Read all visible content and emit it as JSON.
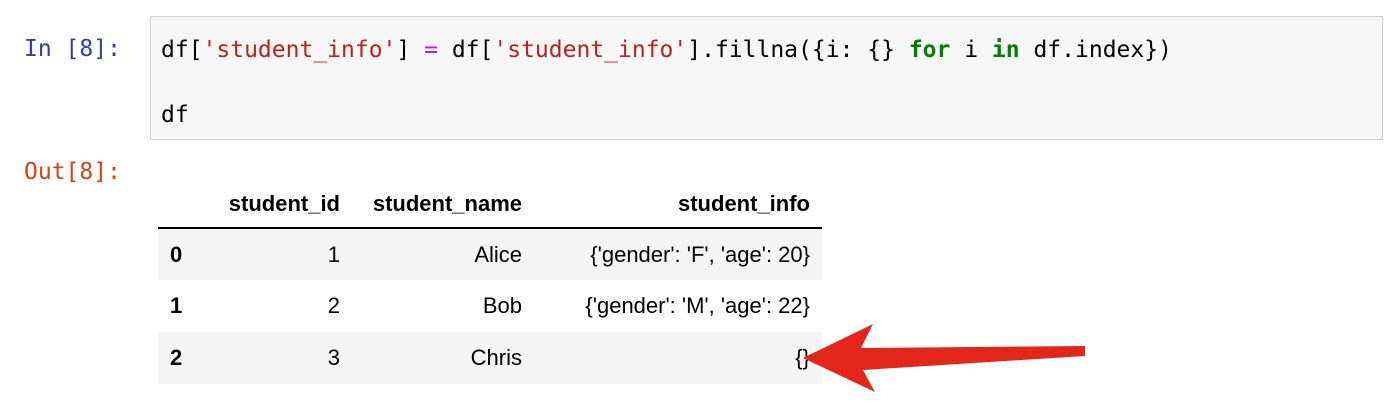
{
  "input_prompt": "In [8]:",
  "output_prompt": "Out[8]:",
  "code": {
    "line1": {
      "t1": "df[",
      "s1": "'student_info'",
      "t2": "] ",
      "eq": "=",
      "t3": " df[",
      "s2": "'student_info'",
      "t4": "].fillna({i: {} ",
      "kw_for": "for",
      "t5": " i ",
      "kw_in": "in",
      "t6": " df.index})"
    },
    "line2": "df"
  },
  "table": {
    "columns": [
      "",
      "student_id",
      "student_name",
      "student_info"
    ],
    "rows": [
      {
        "index": "0",
        "student_id": "1",
        "student_name": "Alice",
        "student_info": "{'gender': 'F', 'age': 20}"
      },
      {
        "index": "1",
        "student_id": "2",
        "student_name": "Bob",
        "student_info": "{'gender': 'M', 'age': 22}"
      },
      {
        "index": "2",
        "student_id": "3",
        "student_name": "Chris",
        "student_info": "{}"
      }
    ]
  },
  "colors": {
    "arrow": "#e3261a",
    "input_prompt": "#303f9f",
    "output_prompt": "#d84315",
    "string": "#ba2121",
    "keyword": "#008000"
  },
  "annotation_icon": "red-arrow-icon"
}
